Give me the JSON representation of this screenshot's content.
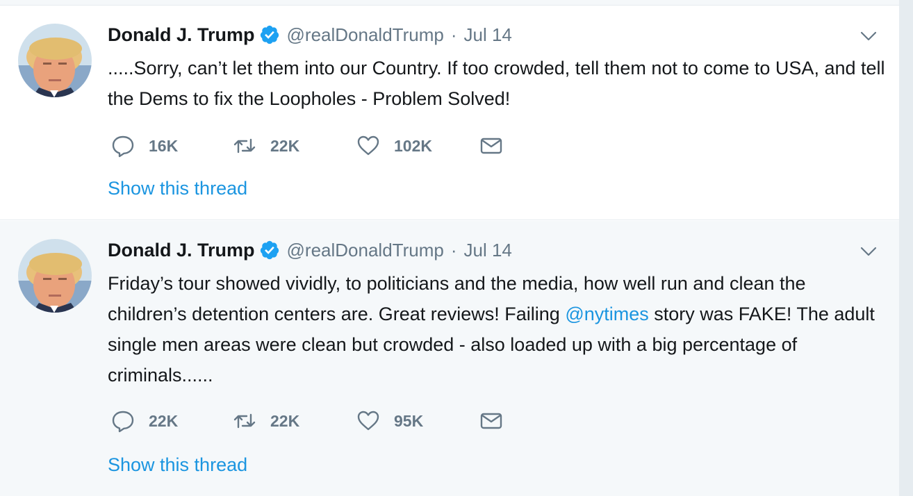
{
  "tweets": [
    {
      "author": {
        "name": "Donald J. Trump",
        "handle": "@realDonaldTrump",
        "verified": true,
        "avatar": "profile-photo"
      },
      "separator": "·",
      "time": "Jul 14",
      "text": ".....Sorry, can’t let them into our Country. If too crowded, tell them not to come to USA, and tell the Dems to fix the Loopholes - Problem Solved!",
      "stats": {
        "replies": "16K",
        "retweets": "22K",
        "likes": "102K"
      },
      "show_thread": "Show this thread"
    },
    {
      "author": {
        "name": "Donald J. Trump",
        "handle": "@realDonaldTrump",
        "verified": true,
        "avatar": "profile-photo"
      },
      "separator": "·",
      "time": "Jul 14",
      "text_parts": {
        "before": "Friday’s tour showed vividly, to politicians and the media, how well run and clean the children’s detention centers are. Great reviews! Failing ",
        "mention": "@nytimes",
        "after": " story was FAKE! The adult single men areas were clean but crowded - also loaded up with a big percentage of criminals......"
      },
      "stats": {
        "replies": "22K",
        "retweets": "22K",
        "likes": "95K"
      },
      "show_thread": "Show this thread"
    }
  ],
  "icons": {
    "reply": "reply-icon",
    "retweet": "retweet-icon",
    "like": "heart-icon",
    "dm": "envelope-icon",
    "verified": "verified-badge-icon",
    "caret": "chevron-down-icon"
  },
  "colors": {
    "link": "#1b95e0",
    "secondary_text": "#657786",
    "primary_text": "#14171a",
    "highlight_bg": "#f5f8fa"
  }
}
